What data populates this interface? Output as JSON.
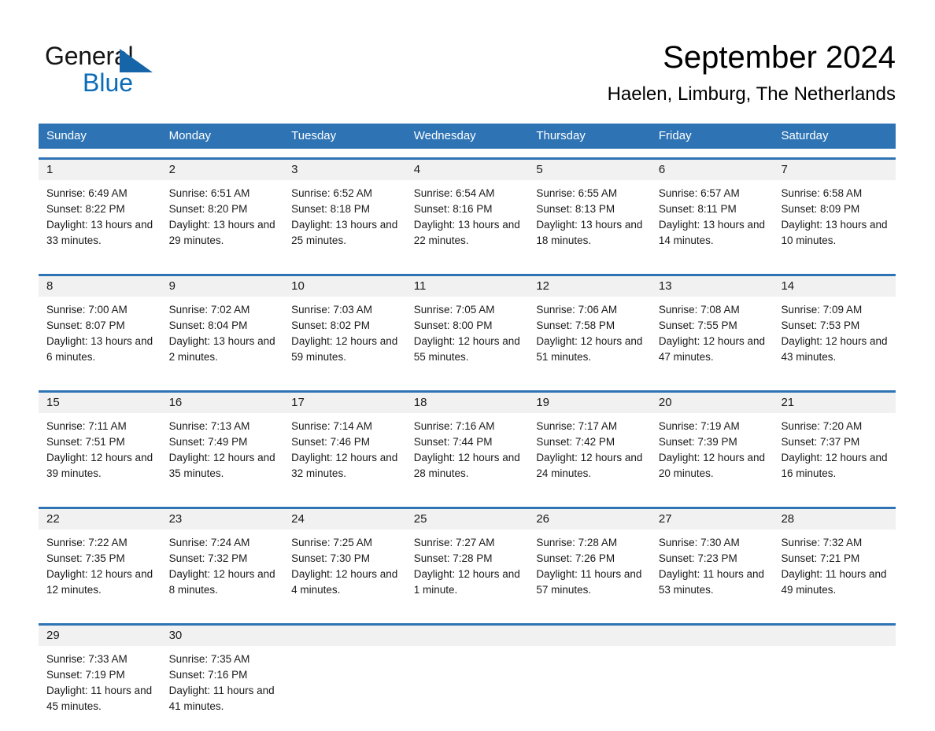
{
  "logo": {
    "word_black": "General",
    "word_blue": "Blue",
    "triangle_color": "#1565a8",
    "blue_color": "#0b6cb7"
  },
  "header": {
    "title": "September 2024",
    "subtitle": "Haelen, Limburg, The Netherlands"
  },
  "colors": {
    "header_blue": "#2e74b5",
    "daynum_band": "#f1f1f1",
    "text": "#1a1a1a"
  },
  "weekdays": [
    "Sunday",
    "Monday",
    "Tuesday",
    "Wednesday",
    "Thursday",
    "Friday",
    "Saturday"
  ],
  "weeks": [
    {
      "days": [
        {
          "num": "1",
          "sunrise": "Sunrise: 6:49 AM",
          "sunset": "Sunset: 8:22 PM",
          "daylight": "Daylight: 13 hours and 33 minutes."
        },
        {
          "num": "2",
          "sunrise": "Sunrise: 6:51 AM",
          "sunset": "Sunset: 8:20 PM",
          "daylight": "Daylight: 13 hours and 29 minutes."
        },
        {
          "num": "3",
          "sunrise": "Sunrise: 6:52 AM",
          "sunset": "Sunset: 8:18 PM",
          "daylight": "Daylight: 13 hours and 25 minutes."
        },
        {
          "num": "4",
          "sunrise": "Sunrise: 6:54 AM",
          "sunset": "Sunset: 8:16 PM",
          "daylight": "Daylight: 13 hours and 22 minutes."
        },
        {
          "num": "5",
          "sunrise": "Sunrise: 6:55 AM",
          "sunset": "Sunset: 8:13 PM",
          "daylight": "Daylight: 13 hours and 18 minutes."
        },
        {
          "num": "6",
          "sunrise": "Sunrise: 6:57 AM",
          "sunset": "Sunset: 8:11 PM",
          "daylight": "Daylight: 13 hours and 14 minutes."
        },
        {
          "num": "7",
          "sunrise": "Sunrise: 6:58 AM",
          "sunset": "Sunset: 8:09 PM",
          "daylight": "Daylight: 13 hours and 10 minutes."
        }
      ]
    },
    {
      "days": [
        {
          "num": "8",
          "sunrise": "Sunrise: 7:00 AM",
          "sunset": "Sunset: 8:07 PM",
          "daylight": "Daylight: 13 hours and 6 minutes."
        },
        {
          "num": "9",
          "sunrise": "Sunrise: 7:02 AM",
          "sunset": "Sunset: 8:04 PM",
          "daylight": "Daylight: 13 hours and 2 minutes."
        },
        {
          "num": "10",
          "sunrise": "Sunrise: 7:03 AM",
          "sunset": "Sunset: 8:02 PM",
          "daylight": "Daylight: 12 hours and 59 minutes."
        },
        {
          "num": "11",
          "sunrise": "Sunrise: 7:05 AM",
          "sunset": "Sunset: 8:00 PM",
          "daylight": "Daylight: 12 hours and 55 minutes."
        },
        {
          "num": "12",
          "sunrise": "Sunrise: 7:06 AM",
          "sunset": "Sunset: 7:58 PM",
          "daylight": "Daylight: 12 hours and 51 minutes."
        },
        {
          "num": "13",
          "sunrise": "Sunrise: 7:08 AM",
          "sunset": "Sunset: 7:55 PM",
          "daylight": "Daylight: 12 hours and 47 minutes."
        },
        {
          "num": "14",
          "sunrise": "Sunrise: 7:09 AM",
          "sunset": "Sunset: 7:53 PM",
          "daylight": "Daylight: 12 hours and 43 minutes."
        }
      ]
    },
    {
      "days": [
        {
          "num": "15",
          "sunrise": "Sunrise: 7:11 AM",
          "sunset": "Sunset: 7:51 PM",
          "daylight": "Daylight: 12 hours and 39 minutes."
        },
        {
          "num": "16",
          "sunrise": "Sunrise: 7:13 AM",
          "sunset": "Sunset: 7:49 PM",
          "daylight": "Daylight: 12 hours and 35 minutes."
        },
        {
          "num": "17",
          "sunrise": "Sunrise: 7:14 AM",
          "sunset": "Sunset: 7:46 PM",
          "daylight": "Daylight: 12 hours and 32 minutes."
        },
        {
          "num": "18",
          "sunrise": "Sunrise: 7:16 AM",
          "sunset": "Sunset: 7:44 PM",
          "daylight": "Daylight: 12 hours and 28 minutes."
        },
        {
          "num": "19",
          "sunrise": "Sunrise: 7:17 AM",
          "sunset": "Sunset: 7:42 PM",
          "daylight": "Daylight: 12 hours and 24 minutes."
        },
        {
          "num": "20",
          "sunrise": "Sunrise: 7:19 AM",
          "sunset": "Sunset: 7:39 PM",
          "daylight": "Daylight: 12 hours and 20 minutes."
        },
        {
          "num": "21",
          "sunrise": "Sunrise: 7:20 AM",
          "sunset": "Sunset: 7:37 PM",
          "daylight": "Daylight: 12 hours and 16 minutes."
        }
      ]
    },
    {
      "days": [
        {
          "num": "22",
          "sunrise": "Sunrise: 7:22 AM",
          "sunset": "Sunset: 7:35 PM",
          "daylight": "Daylight: 12 hours and 12 minutes."
        },
        {
          "num": "23",
          "sunrise": "Sunrise: 7:24 AM",
          "sunset": "Sunset: 7:32 PM",
          "daylight": "Daylight: 12 hours and 8 minutes."
        },
        {
          "num": "24",
          "sunrise": "Sunrise: 7:25 AM",
          "sunset": "Sunset: 7:30 PM",
          "daylight": "Daylight: 12 hours and 4 minutes."
        },
        {
          "num": "25",
          "sunrise": "Sunrise: 7:27 AM",
          "sunset": "Sunset: 7:28 PM",
          "daylight": "Daylight: 12 hours and 1 minute."
        },
        {
          "num": "26",
          "sunrise": "Sunrise: 7:28 AM",
          "sunset": "Sunset: 7:26 PM",
          "daylight": "Daylight: 11 hours and 57 minutes."
        },
        {
          "num": "27",
          "sunrise": "Sunrise: 7:30 AM",
          "sunset": "Sunset: 7:23 PM",
          "daylight": "Daylight: 11 hours and 53 minutes."
        },
        {
          "num": "28",
          "sunrise": "Sunrise: 7:32 AM",
          "sunset": "Sunset: 7:21 PM",
          "daylight": "Daylight: 11 hours and 49 minutes."
        }
      ]
    },
    {
      "days": [
        {
          "num": "29",
          "sunrise": "Sunrise: 7:33 AM",
          "sunset": "Sunset: 7:19 PM",
          "daylight": "Daylight: 11 hours and 45 minutes."
        },
        {
          "num": "30",
          "sunrise": "Sunrise: 7:35 AM",
          "sunset": "Sunset: 7:16 PM",
          "daylight": "Daylight: 11 hours and 41 minutes."
        },
        {
          "num": "",
          "sunrise": "",
          "sunset": "",
          "daylight": ""
        },
        {
          "num": "",
          "sunrise": "",
          "sunset": "",
          "daylight": ""
        },
        {
          "num": "",
          "sunrise": "",
          "sunset": "",
          "daylight": ""
        },
        {
          "num": "",
          "sunrise": "",
          "sunset": "",
          "daylight": ""
        },
        {
          "num": "",
          "sunrise": "",
          "sunset": "",
          "daylight": ""
        }
      ]
    }
  ]
}
